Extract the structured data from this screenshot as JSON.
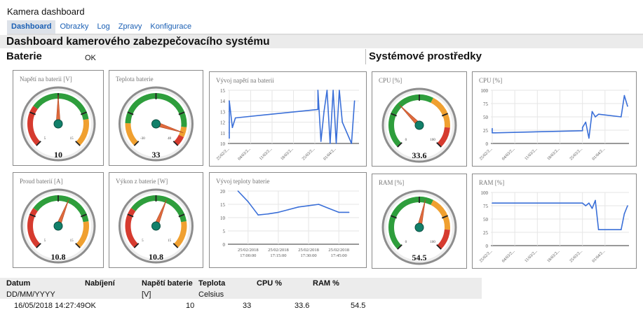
{
  "app": {
    "title": "Kamera dashboard"
  },
  "nav": {
    "tabs": [
      "Dashboard",
      "Obrazky",
      "Log",
      "Zpravy",
      "Konfigurace"
    ],
    "active": "Dashboard"
  },
  "heading": "Dashboard kamerového zabezpečovacího systému",
  "sections": {
    "battery": "Baterie",
    "battery_status": "OK",
    "system": "Systémové prostředky"
  },
  "gauges": [
    {
      "id": "voltage",
      "title": "Napětí na baterii [V]",
      "value": "10",
      "value_num": 10,
      "min": 5,
      "max": 15,
      "min_label": "5",
      "max_label": "15",
      "bands": [
        [
          "#d63b2f",
          5,
          8
        ],
        [
          "#2e9e3c",
          8,
          13
        ],
        [
          "#f0a030",
          13,
          15
        ]
      ]
    },
    {
      "id": "temp",
      "title": "Teplota baterie",
      "value": "33",
      "value_num": 33,
      "min": -30,
      "max": 40,
      "min_label": "-30",
      "max_label": "40",
      "bands": [
        [
          "#f0a030",
          -30,
          -18
        ],
        [
          "#2e9e3c",
          -18,
          30
        ],
        [
          "#f0a030",
          30,
          35
        ],
        [
          "#d63b2f",
          35,
          40
        ]
      ]
    },
    {
      "id": "current",
      "title": "Proud baterií [A]",
      "value": "10.8",
      "value_num": 10.8,
      "min": 5,
      "max": 15,
      "min_label": "5",
      "max_label": "15",
      "bands": [
        [
          "#d63b2f",
          5,
          8
        ],
        [
          "#2e9e3c",
          8,
          13
        ],
        [
          "#f0a030",
          13,
          15
        ]
      ]
    },
    {
      "id": "power",
      "title": "Výkon z baterie [W]",
      "value": "10.8",
      "value_num": 10.8,
      "min": 5,
      "max": 15,
      "min_label": "5",
      "max_label": "15",
      "bands": [
        [
          "#d63b2f",
          5,
          8
        ],
        [
          "#2e9e3c",
          8,
          13
        ],
        [
          "#f0a030",
          13,
          15
        ]
      ]
    },
    {
      "id": "cpu",
      "title": "CPU [%]",
      "value": "33.6",
      "value_num": 33.6,
      "min": 0,
      "max": 100,
      "min_label": "0",
      "max_label": "100",
      "bands": [
        [
          "#2e9e3c",
          0,
          60
        ],
        [
          "#f0a030",
          60,
          85
        ],
        [
          "#d63b2f",
          85,
          100
        ]
      ]
    },
    {
      "id": "ram",
      "title": "RAM [%]",
      "value": "54.5",
      "value_num": 54.5,
      "min": 0,
      "max": 100,
      "min_label": "0",
      "max_label": "100",
      "bands": [
        [
          "#2e9e3c",
          0,
          60
        ],
        [
          "#f0a030",
          60,
          85
        ],
        [
          "#d63b2f",
          85,
          100
        ]
      ]
    }
  ],
  "chart_data": [
    {
      "type": "line",
      "title": "Vývoj napětí na baterii",
      "ylim": [
        10,
        15
      ],
      "yticks": [
        10,
        11,
        12,
        13,
        14,
        15
      ],
      "xticks": [
        "25/02/2...",
        "04/03/2...",
        "11/03/2...",
        "18/03/2...",
        "25/03/2...",
        "01/04/2..."
      ],
      "x": [
        "25/02/2018",
        "25/02/2018",
        "26/02/2018",
        "27/02/2018",
        "26/03/2018",
        "26/03/2018",
        "27/03/2018",
        "28/03/2018",
        "29/03/2018",
        "30/03/2018",
        "31/03/2018",
        "01/04/2018",
        "02/04/2018",
        "03/04/2018",
        "06/04/2018",
        "07/04/2018"
      ],
      "values": [
        10.5,
        14.0,
        11.5,
        12.4,
        13.2,
        15.0,
        10.2,
        13.0,
        15.0,
        10.0,
        15.0,
        10.0,
        15.0,
        12.0,
        10.0,
        14.0
      ]
    },
    {
      "type": "line",
      "title": "Vývoj teploty baterie",
      "ylim": [
        0,
        20
      ],
      "yticks": [
        0,
        5,
        10,
        15,
        20
      ],
      "xticks": [
        [
          "25/02/2018",
          "17:00:00"
        ],
        [
          "25/02/2018",
          "17:15:00"
        ],
        [
          "25/02/2018",
          "17:30:00"
        ],
        [
          "25/02/2018",
          "17:45:00"
        ]
      ],
      "x": [
        "16:55",
        "17:00",
        "17:05",
        "17:10",
        "17:15",
        "17:20",
        "17:25",
        "17:30",
        "17:35",
        "17:40",
        "17:45",
        "17:50"
      ],
      "values": [
        20,
        16,
        11,
        11.4,
        12,
        13,
        14,
        14.5,
        15,
        13.5,
        12,
        12
      ]
    },
    {
      "type": "line",
      "title": "CPU [%]",
      "ylim": [
        0,
        100
      ],
      "yticks": [
        0,
        25,
        50,
        75,
        100
      ],
      "xticks": [
        "25/02/2...",
        "04/03/2...",
        "11/03/2...",
        "18/03/2...",
        "25/03/2...",
        "01/04/2..."
      ],
      "x": [
        "25/02/2018",
        "25/02/2018",
        "26/02/2018",
        "25/03/2018",
        "25/03/2018",
        "26/03/2018",
        "27/03/2018",
        "28/03/2018",
        "29/03/2018",
        "30/03/2018",
        "06/04/2018",
        "07/04/2018",
        "08/04/2018"
      ],
      "values": [
        28,
        20,
        20,
        24,
        30,
        40,
        10,
        60,
        50,
        55,
        50,
        90,
        70
      ]
    },
    {
      "type": "line",
      "title": "RAM [%]",
      "ylim": [
        0,
        100
      ],
      "yticks": [
        0,
        25,
        50,
        75,
        100
      ],
      "xticks": [
        "25/02/2...",
        "04/03/2...",
        "11/03/2...",
        "18/03/2...",
        "25/03/2...",
        "01/04/2..."
      ],
      "x": [
        "25/02/2018",
        "26/02/2018",
        "25/03/2018",
        "26/03/2018",
        "27/03/2018",
        "28/03/2018",
        "29/03/2018",
        "30/03/2018",
        "02/04/2018",
        "06/04/2018",
        "07/04/2018",
        "08/04/2018"
      ],
      "values": [
        80,
        80,
        80,
        75,
        80,
        70,
        85,
        30,
        30,
        30,
        60,
        75
      ]
    }
  ],
  "table": {
    "headers": [
      "Datum",
      "Nabíjení",
      "Napětí baterie",
      "Teplota",
      "CPU %",
      "RAM %"
    ],
    "units": [
      "DD/MM/YYYY",
      "",
      "[V]",
      "Celsius",
      "",
      ""
    ],
    "rows": [
      [
        "16/05/2018 14:27:49",
        "OK",
        "10",
        "33",
        "33.6",
        "54.5"
      ]
    ]
  }
}
